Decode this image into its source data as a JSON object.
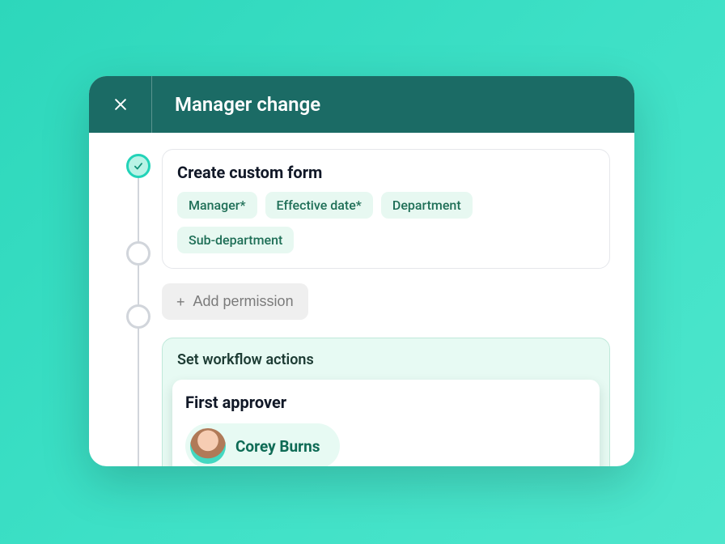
{
  "modal": {
    "title": "Manager change"
  },
  "steps": {
    "form": {
      "title": "Create custom form",
      "fields": [
        "Manager*",
        "Effective date*",
        "Department",
        "Sub-department"
      ]
    },
    "add_permission_label": "Add permission",
    "workflow": {
      "panel_title": "Set workflow actions",
      "card_title": "First approver",
      "approver_name": "Corey Burns"
    }
  }
}
